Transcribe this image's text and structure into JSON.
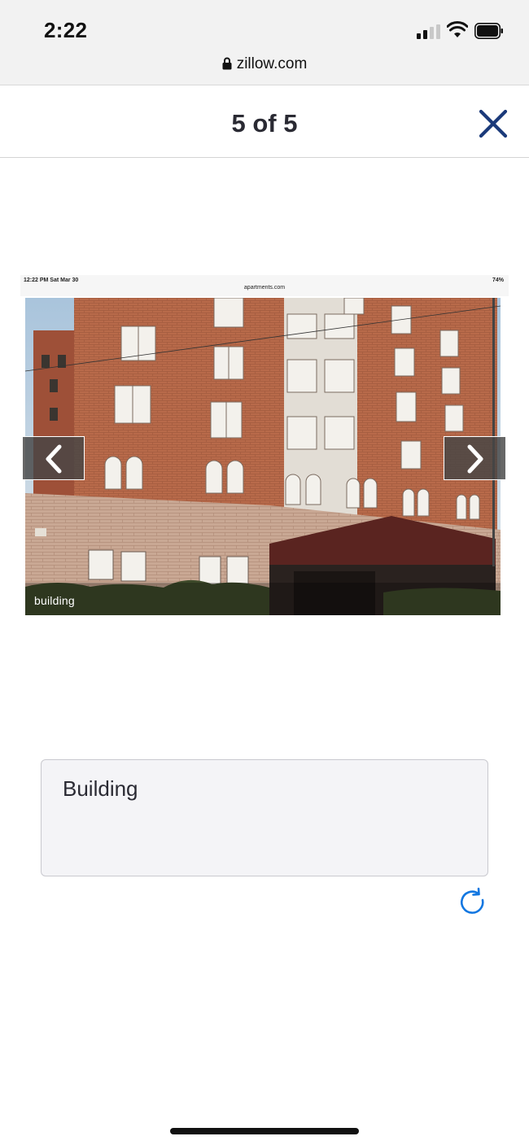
{
  "status_bar": {
    "time": "2:22",
    "url": "zillow.com",
    "icons": [
      "signal-icon",
      "wifi-icon",
      "battery-icon",
      "lock-icon"
    ]
  },
  "header": {
    "title": "5 of 5",
    "close_icon": "close-icon",
    "accent_color": "#1b3a7a"
  },
  "photo": {
    "inner_time": "12:22 PM   Sat Mar 30",
    "inner_url": "apartments.com",
    "inner_battery": "74%",
    "caption": "building",
    "prev_icon": "chevron-left-icon",
    "next_icon": "chevron-right-icon"
  },
  "caption_box": {
    "value": "Building"
  },
  "refresh": {
    "icon": "refresh-icon",
    "color": "#1277e1"
  }
}
